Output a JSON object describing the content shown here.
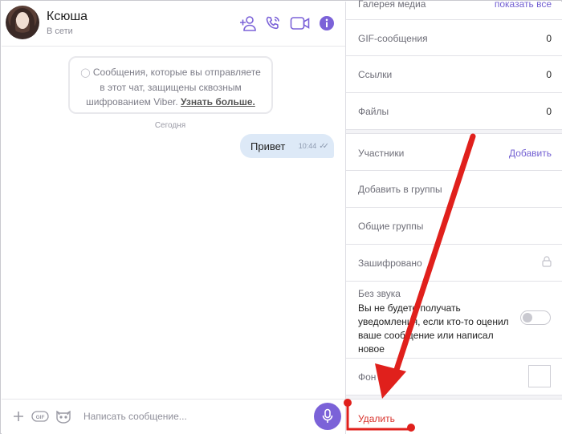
{
  "header": {
    "contact_name": "Ксюша",
    "contact_status": "В сети",
    "icons": [
      "add-participant-icon",
      "phone-icon",
      "video-camera-icon",
      "info-icon"
    ]
  },
  "chat": {
    "e2e_notice": "Сообщения, которые вы отправляете в этот чат, защищены сквозным шифрованием Viber.",
    "e2e_learn_more": "Узнать больше.",
    "date_separator": "Сегодня",
    "message": {
      "text": "Привет",
      "time": "10:44"
    }
  },
  "composer": {
    "placeholder": "Написать сообщение...",
    "gif_label": "GIF"
  },
  "info_panel": {
    "media_gallery": {
      "label": "Галерея медиа",
      "action": "показать все"
    },
    "gif_messages": {
      "label": "GIF-сообщения",
      "count": "0"
    },
    "links": {
      "label": "Ссылки",
      "count": "0"
    },
    "files": {
      "label": "Файлы",
      "count": "0"
    },
    "participants": {
      "label": "Участники",
      "action": "Добавить"
    },
    "add_to_groups": "Добавить в группы",
    "common_groups": "Общие группы",
    "encrypted": "Зашифровано",
    "mute": {
      "title": "Без звука",
      "description": "Вы не будете получать уведомления, если кто-то оценил ваше сообщение или написал новое"
    },
    "background_label": "Фон",
    "delete_label": "Удалить"
  },
  "colors": {
    "accent": "#7b62d8",
    "link": "#7360d2",
    "bubble": "#dde9f7",
    "danger": "#d8322c",
    "annotation": "#e0201c"
  }
}
